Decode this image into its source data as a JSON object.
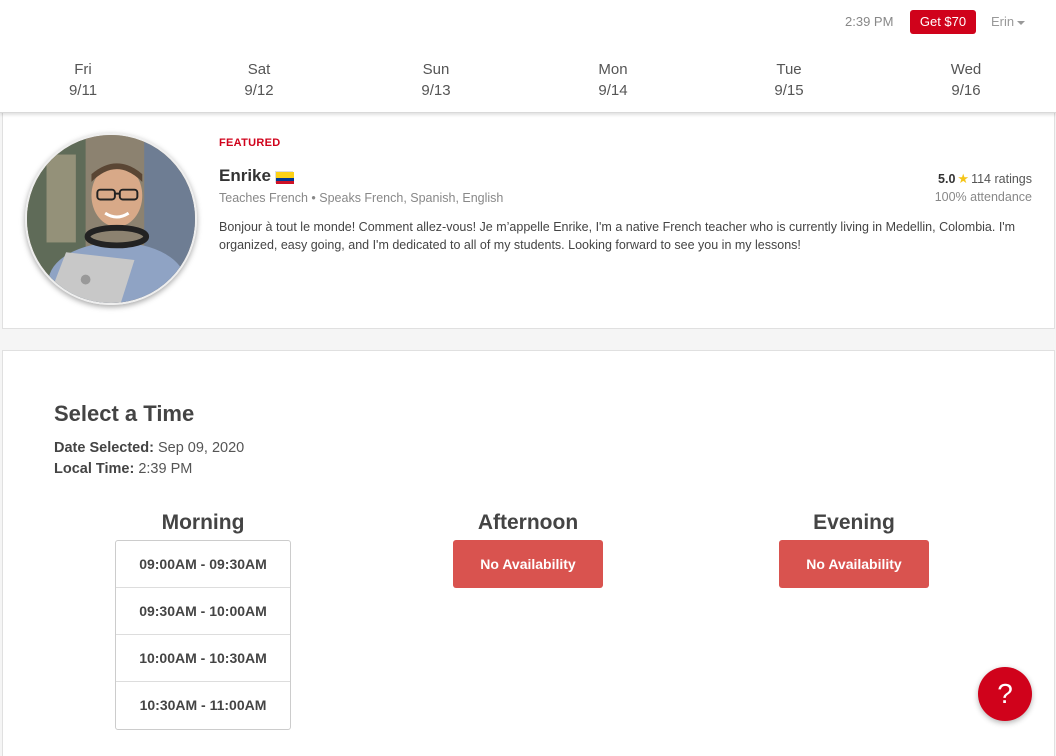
{
  "header": {
    "time": "2:39 PM",
    "promo_label": "Get $70",
    "user_name": "Erin"
  },
  "days": [
    {
      "name": "Fri",
      "date": "9/11"
    },
    {
      "name": "Sat",
      "date": "9/12"
    },
    {
      "name": "Sun",
      "date": "9/13"
    },
    {
      "name": "Mon",
      "date": "9/14"
    },
    {
      "name": "Tue",
      "date": "9/15"
    },
    {
      "name": "Wed",
      "date": "9/16"
    }
  ],
  "teacher": {
    "featured_label": "FEATURED",
    "name": "Enrike",
    "flag": "colombia-flag-icon",
    "teaches": "Teaches French • Speaks French, Spanish, English",
    "rating": "5.0",
    "ratings_count": "114 ratings",
    "attendance": "100% attendance",
    "bio": "Bonjour à tout le monde! Comment allez-vous! Je m’appelle Enrike, I'm a native French teacher who is currently living in Medellin, Colombia. I'm organized, easy going, and I'm dedicated to all of my students. Looking forward to see you in my lessons!"
  },
  "select_time": {
    "title": "Select a Time",
    "date_label": "Date Selected:",
    "date_value": "Sep 09, 2020",
    "local_label": "Local Time:",
    "local_value": "2:39 PM",
    "morning": {
      "label": "Morning",
      "slots": [
        "09:00AM - 09:30AM",
        "09:30AM - 10:00AM",
        "10:00AM - 10:30AM",
        "10:30AM - 11:00AM"
      ]
    },
    "afternoon": {
      "label": "Afternoon",
      "status": "No Availability"
    },
    "evening": {
      "label": "Evening",
      "status": "No Availability"
    }
  },
  "help": {
    "icon": "question-icon",
    "glyph": "?"
  },
  "colors": {
    "brand_red": "#d0021b",
    "no_availability": "#d9534f",
    "star": "#f5c518"
  }
}
